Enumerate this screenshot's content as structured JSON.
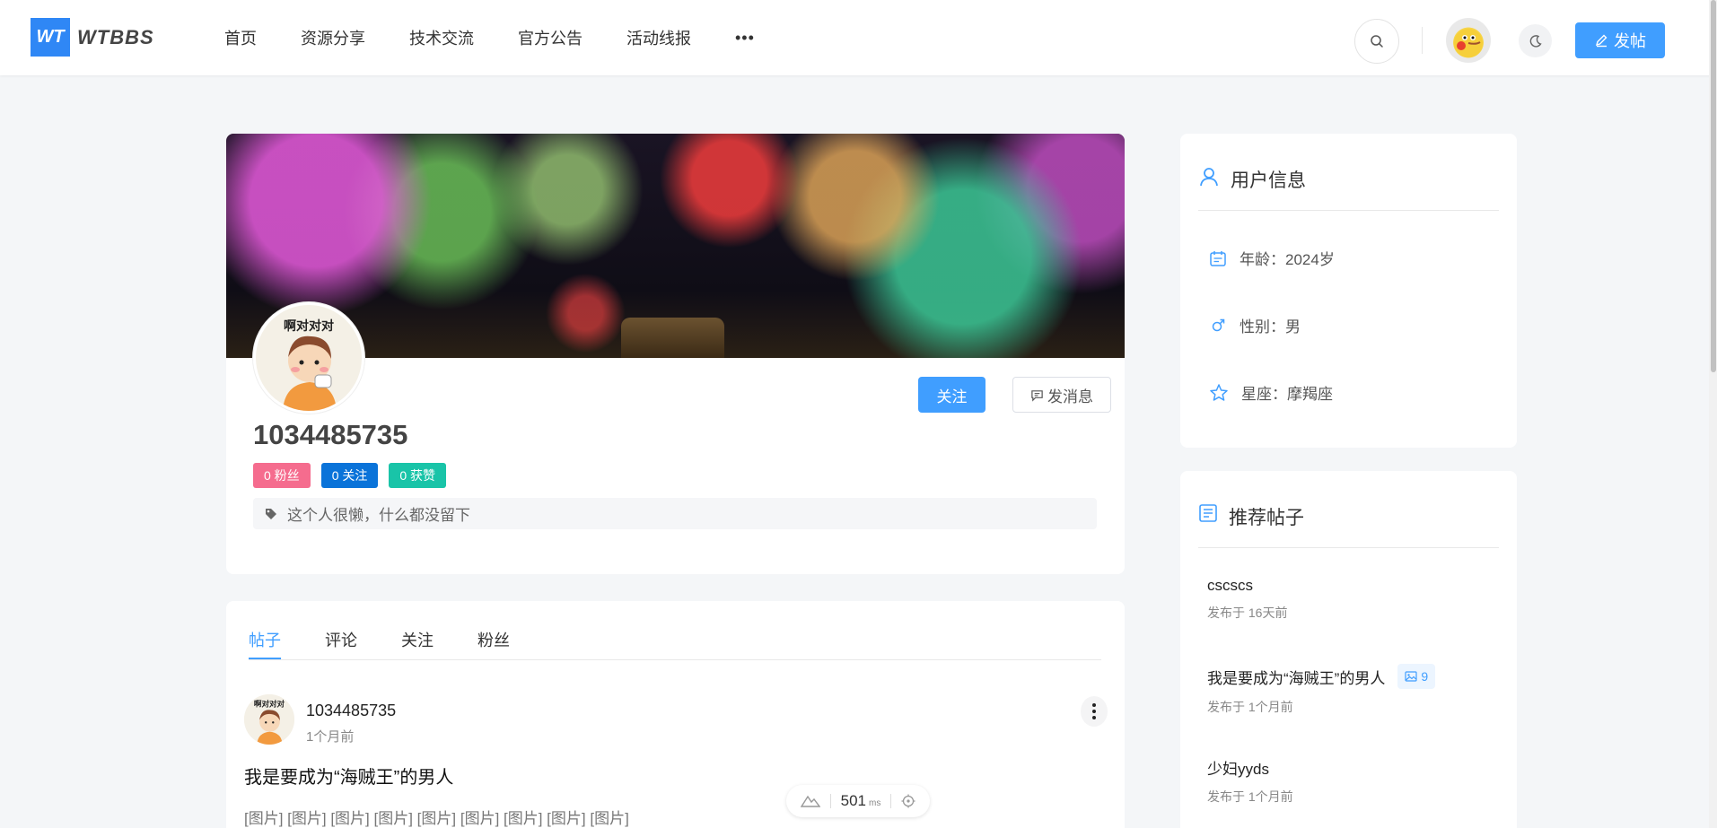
{
  "header": {
    "logo_mark": "WT",
    "logo_text": "WTBBS",
    "nav": [
      "首页",
      "资源分享",
      "技术交流",
      "官方公告",
      "活动线报"
    ],
    "nav_more": "•••",
    "post_button": "发帖"
  },
  "profile": {
    "avatar_caption": "啊对对对",
    "name": "1034485735",
    "follow_button": "关注",
    "message_button": "发消息",
    "badges": {
      "fans": "0 粉丝",
      "following": "0 关注",
      "likes": "0 获赞"
    },
    "bio": "这个人很懒，什么都没留下",
    "colors": {
      "fans": "#f56c8e",
      "following": "#0a73d9",
      "likes": "#19c4a8",
      "primary": "#409eff"
    }
  },
  "tabs": [
    "帖子",
    "评论",
    "关注",
    "粉丝"
  ],
  "post": {
    "avatar_caption": "啊对对对",
    "author": "1034485735",
    "time": "1个月前",
    "title": "我是要成为“海贼王”的男人",
    "body": "[图片] [图片] [图片] [图片] [图片] [图片] [图片] [图片] [图片]"
  },
  "perf": {
    "value": "501",
    "unit": "ms"
  },
  "user_info": {
    "title": "用户信息",
    "age": "年龄：2024岁",
    "gender": "性别：男",
    "zodiac": "星座：摩羯座"
  },
  "recommended": {
    "title": "推荐帖子",
    "items": [
      {
        "title": "cscscs",
        "time": "发布于 16天前",
        "images": ""
      },
      {
        "title": "我是要成为“海贼王”的男人",
        "time": "发布于 1个月前",
        "images": "9"
      },
      {
        "title": "少妇yyds",
        "time": "发布于 1个月前",
        "images": ""
      }
    ]
  }
}
